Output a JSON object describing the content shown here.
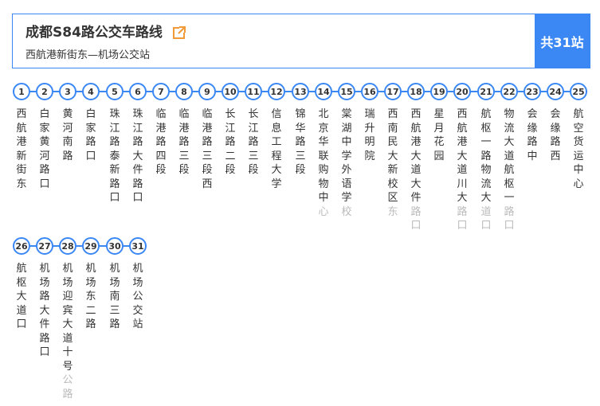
{
  "route": {
    "title": "成都S84路公交车路线",
    "subtitle": "西航港新街东—机场公交站",
    "stop_count": "共31站",
    "accent_color": "#3b88f5",
    "edit_icon": "external-link-icon",
    "edit_icon_color": "#f29a38"
  },
  "rows": [
    [
      {
        "num": "1",
        "name": "西航港新街东",
        "faded": 0
      },
      {
        "num": "2",
        "name": "白家黄河路口",
        "faded": 0
      },
      {
        "num": "3",
        "name": "黄河南路",
        "faded": 0
      },
      {
        "num": "4",
        "name": "白家路口",
        "faded": 0
      },
      {
        "num": "5",
        "name": "珠江路泰新路口",
        "faded": 0
      },
      {
        "num": "6",
        "name": "珠江路大件路口",
        "faded": 0
      },
      {
        "num": "7",
        "name": "临港路四段",
        "faded": 0
      },
      {
        "num": "8",
        "name": "临港路三段",
        "faded": 0
      },
      {
        "num": "9",
        "name": "临港路三段西",
        "faded": 0
      },
      {
        "num": "10",
        "name": "长江路二段",
        "faded": 0
      },
      {
        "num": "11",
        "name": "长江路三段",
        "faded": 0
      },
      {
        "num": "12",
        "name": "信息工程大学",
        "faded": 0
      },
      {
        "num": "13",
        "name": "锦华路三段",
        "faded": 0
      },
      {
        "num": "14",
        "name": "北京华联购物中心",
        "faded": 1
      },
      {
        "num": "15",
        "name": "棠湖中学外语学校",
        "faded": 1
      },
      {
        "num": "16",
        "name": "瑞升明院",
        "faded": 0
      },
      {
        "num": "17",
        "name": "西南民大新校区东",
        "faded": 1
      },
      {
        "num": "18",
        "name": "西航港大道大件路口",
        "faded": 2
      },
      {
        "num": "19",
        "name": "星月花园",
        "faded": 0
      },
      {
        "num": "20",
        "name": "西航港大道川大路口",
        "faded": 2
      },
      {
        "num": "21",
        "name": "航枢一路物流大道口",
        "faded": 2
      },
      {
        "num": "22",
        "name": "物流大道航枢一路口",
        "faded": 2
      },
      {
        "num": "23",
        "name": "会缘路中",
        "faded": 0
      },
      {
        "num": "24",
        "name": "会缘路西",
        "faded": 0
      },
      {
        "num": "25",
        "name": "航空货运中心",
        "faded": 0
      }
    ],
    [
      {
        "num": "26",
        "name": "航枢大道口",
        "faded": 0
      },
      {
        "num": "27",
        "name": "机场路大件路口",
        "faded": 0
      },
      {
        "num": "28",
        "name": "机场迎宾大道十号公路",
        "faded": 2
      },
      {
        "num": "29",
        "name": "机场东二路",
        "faded": 0
      },
      {
        "num": "30",
        "name": "机场南三路",
        "faded": 0
      },
      {
        "num": "31",
        "name": "机场公交站",
        "faded": 0
      }
    ]
  ]
}
